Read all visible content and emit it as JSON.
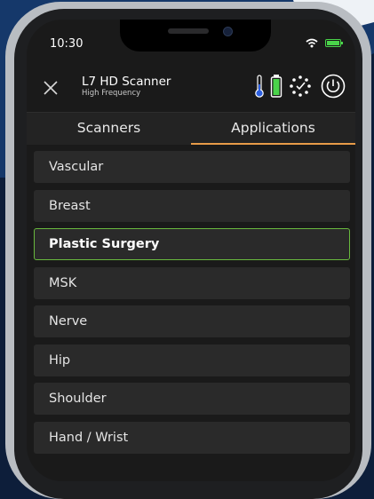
{
  "status_bar": {
    "time": "10:30"
  },
  "header": {
    "title": "L7 HD Scanner",
    "subtitle": "High Frequency",
    "icons": [
      "close-icon",
      "thermometer-icon",
      "battery-icon",
      "connection-spinner-icon",
      "power-icon"
    ]
  },
  "tabs": [
    {
      "label": "Scanners",
      "active": false
    },
    {
      "label": "Applications",
      "active": true
    }
  ],
  "applications": [
    {
      "label": "Vascular",
      "selected": false
    },
    {
      "label": "Breast",
      "selected": false
    },
    {
      "label": "Plastic Surgery",
      "selected": true
    },
    {
      "label": "MSK",
      "selected": false
    },
    {
      "label": "Nerve",
      "selected": false
    },
    {
      "label": "Hip",
      "selected": false
    },
    {
      "label": "Shoulder",
      "selected": false
    },
    {
      "label": "Hand / Wrist",
      "selected": false
    }
  ],
  "colors": {
    "accent_tab": "#e79b48",
    "selected_border": "#69b93e",
    "background": "#0d1e3a",
    "battery_green": "#4ad44a"
  }
}
